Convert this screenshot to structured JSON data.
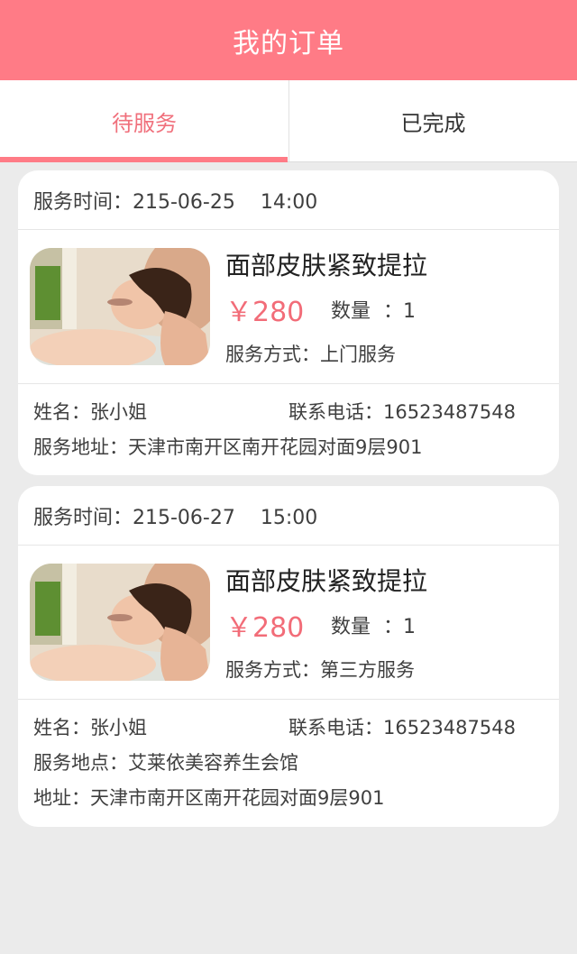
{
  "header": {
    "title": "我的订单"
  },
  "tabs": [
    {
      "label": "待服务",
      "active": true
    },
    {
      "label": "已完成",
      "active": false
    }
  ],
  "colors": {
    "brand": "#ff7b86",
    "price": "#f26c78",
    "background": "#ebebeb"
  },
  "orders": [
    {
      "service_time": "服务时间：215-06-25    14:00",
      "product_name": "面部皮肤紧致提拉",
      "price": "￥280",
      "quantity": "数量  ：1",
      "service_mode": "服务方式：上门服务",
      "name": "姓名：张小姐",
      "phone": "联系电话：16523487548",
      "lines": [
        "服务地址：天津市南开区南开花园对面9层901"
      ]
    },
    {
      "service_time": "服务时间：215-06-27    15:00",
      "product_name": "面部皮肤紧致提拉",
      "price": "￥280",
      "quantity": "数量  ：1",
      "service_mode": "服务方式：第三方服务",
      "name": "姓名：张小姐",
      "phone": "联系电话：16523487548",
      "lines": [
        "服务地点：艾莱依美容养生会馆",
        "地址：天津市南开区南开花园对面9层901"
      ]
    }
  ]
}
